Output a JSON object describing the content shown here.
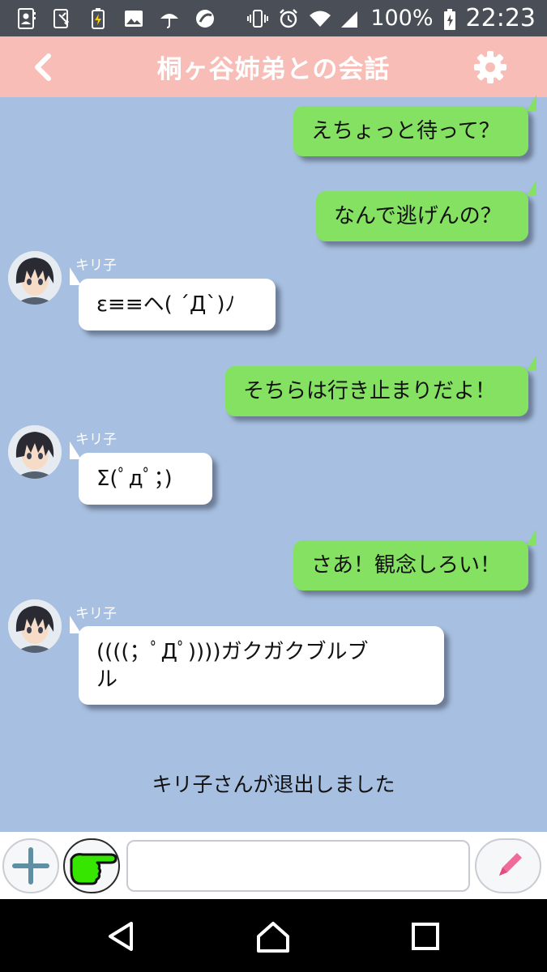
{
  "status_bar": {
    "battery_text": "100%",
    "time": "22:23",
    "icons": [
      "contacts-icon",
      "screenshot-icon",
      "battery-charging-icon",
      "image-icon",
      "umbrella-icon",
      "app-icon",
      "vibrate-icon",
      "alarm-icon",
      "wifi-icon",
      "signal-icon",
      "battery-icon"
    ]
  },
  "header": {
    "title": "桐ヶ谷姉弟との会話",
    "background": "#f7bdb6",
    "back_icon": "chevron-left-icon",
    "settings_icon": "gear-icon"
  },
  "chat": {
    "background": "#a7bfe0",
    "sent_bubble_color": "#84e162",
    "received_bubble_color": "#ffffff",
    "messages": [
      {
        "side": "me",
        "text": "えちょっと待って？"
      },
      {
        "side": "me",
        "text": "なんで逃げんの？"
      },
      {
        "side": "them",
        "sender": "キリ子",
        "text": "ε≡≡ヘ( ´Д`)ﾉ"
      },
      {
        "side": "me",
        "text": "そちらは行き止まりだよ！"
      },
      {
        "side": "them",
        "sender": "キリ子",
        "text": "Σ(ﾟдﾟ；)"
      },
      {
        "side": "me",
        "text": "さあ！観念しろい！"
      },
      {
        "side": "them",
        "sender": "キリ子",
        "text_line1": "((((；ﾟДﾟ))))ガクガクブルブ",
        "text_line2": "ル"
      }
    ],
    "system_message": "キリ子さんが退出しました"
  },
  "input_bar": {
    "add_icon": "plus-icon",
    "sticker_icon": "pointing-hand-icon",
    "message_value": "",
    "edit_icon": "pencil-icon"
  },
  "nav_bar": {
    "icons": [
      "back-triangle-icon",
      "home-icon",
      "recents-icon"
    ]
  }
}
